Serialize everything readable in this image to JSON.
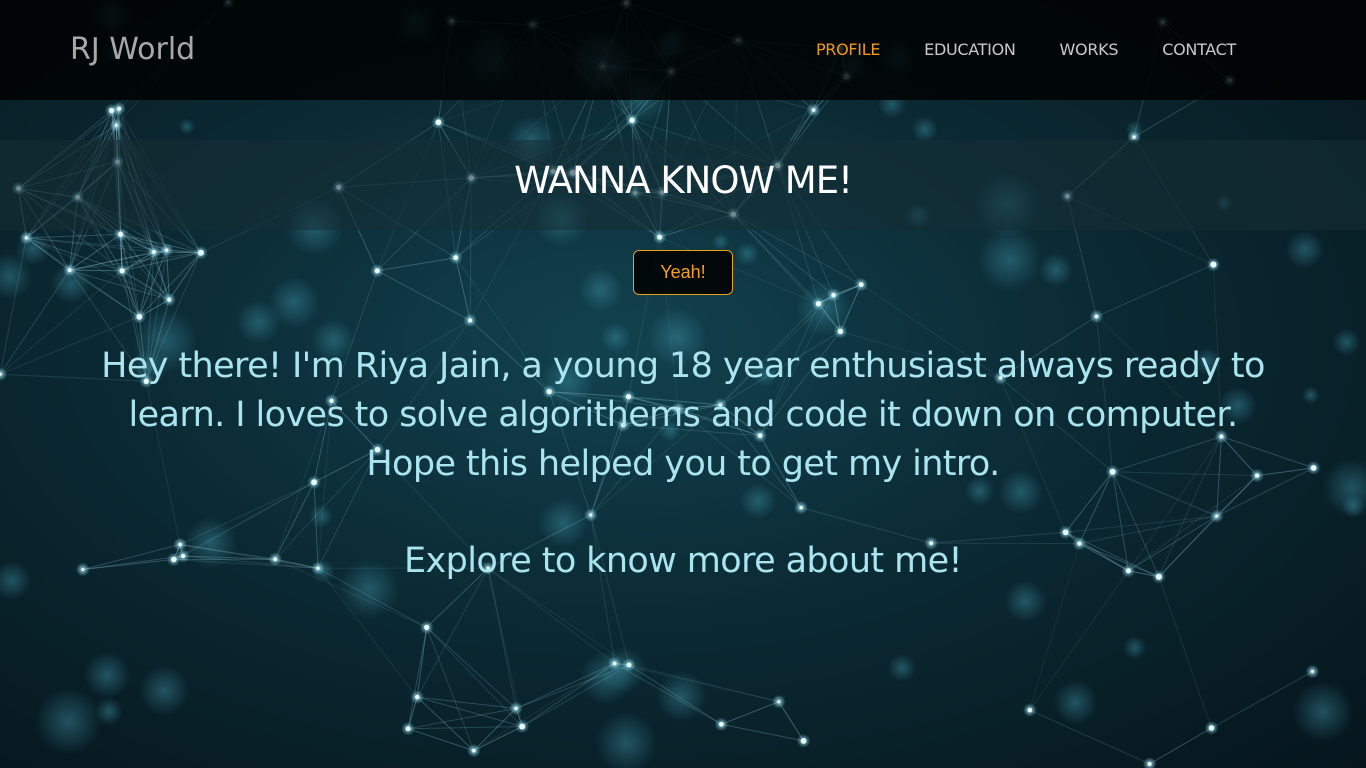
{
  "header": {
    "brand": "RJ World",
    "nav": [
      {
        "label": "PROFILE",
        "active": true
      },
      {
        "label": "EDUCATION",
        "active": false
      },
      {
        "label": "WORKS",
        "active": false
      },
      {
        "label": "CONTACT",
        "active": false
      }
    ]
  },
  "hero": {
    "title": "WANNA KNOW ME!",
    "button_label": "Yeah!",
    "intro": "Hey there! I'm Riya Jain, a young 18 year enthusiast always ready to learn. I loves to solve algorithems and code it down on computer. Hope this helped you to get my intro.",
    "explore": "Explore to know more about me!"
  },
  "colors": {
    "accent": "#ee9b16",
    "nav_text": "#c9c9c9",
    "body_text": "#a9e4ef",
    "brand_text": "#a8a8a8"
  }
}
